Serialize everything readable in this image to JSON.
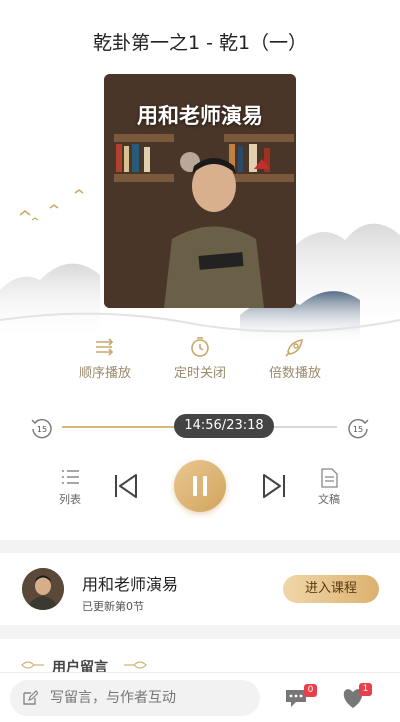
{
  "player": {
    "title": "乾卦第一之1 - 乾1（一）",
    "cover_title": "用和老师演易"
  },
  "options": [
    {
      "label": "顺序播放",
      "icon": "sequential-play-icon"
    },
    {
      "label": "定时关闭",
      "icon": "timer-icon"
    },
    {
      "label": "倍数播放",
      "icon": "speed-icon"
    }
  ],
  "progress": {
    "time": "14:56/23:18",
    "fraction": 0.641,
    "back_label": "15",
    "forward_label": "15"
  },
  "controls": {
    "list_label": "列表",
    "doc_label": "文稿"
  },
  "author": {
    "name": "用和老师演易",
    "subtitle": "已更新第0节",
    "enter_label": "进入课程"
  },
  "comments": {
    "title": "用户留言"
  },
  "bottom": {
    "placeholder": "写留言，与作者互动",
    "comment_badge": "0",
    "like_badge": "1"
  },
  "colors": {
    "accent": "#d9b77a",
    "badge": "#e8404a"
  }
}
